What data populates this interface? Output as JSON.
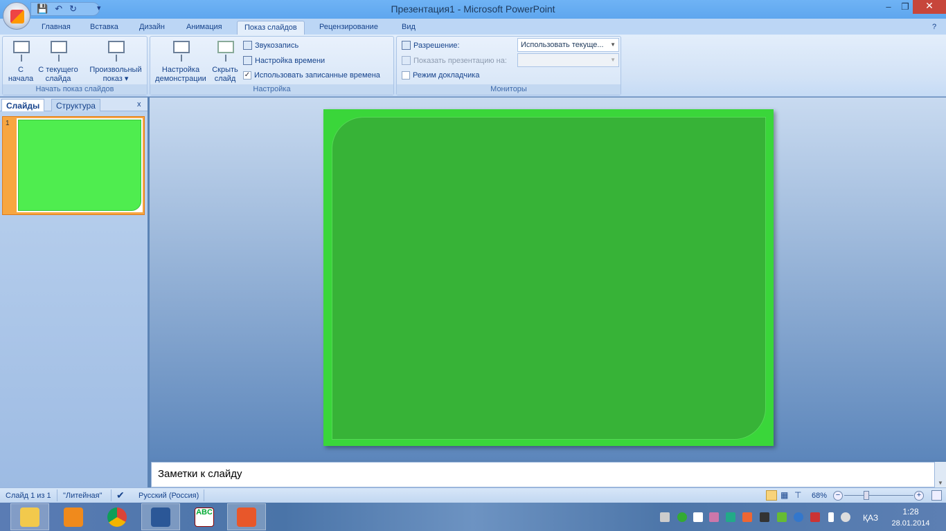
{
  "window": {
    "title": "Презентация1 - Microsoft PowerPoint"
  },
  "tabs": [
    "Главная",
    "Вставка",
    "Дизайн",
    "Анимация",
    "Показ слайдов",
    "Рецензирование",
    "Вид"
  ],
  "ribbon": {
    "start_group": {
      "label": "Начать показ слайдов",
      "from_start": "С\nначала",
      "from_start_l1": "С",
      "from_start_l2": "начала",
      "from_current_l1": "С текущего",
      "from_current_l2": "слайда",
      "custom_l1": "Произвольный",
      "custom_l2": "показ"
    },
    "setup_group": {
      "label": "Настройка",
      "setup_l1": "Настройка",
      "setup_l2": "демонстрации",
      "hide_l1": "Скрыть",
      "hide_l2": "слайд",
      "record": "Звукозапись",
      "rehearse": "Настройка времени",
      "use_timings": "Использовать записанные времена",
      "use_timings_checked": true
    },
    "monitors_group": {
      "label": "Мониторы",
      "resolution_label": "Разрешение:",
      "resolution_value": "Использовать текуще...",
      "show_on_label": "Показать презентацию на:",
      "show_on_value": "",
      "presenter_view": "Режим докладчика",
      "presenter_view_checked": false
    }
  },
  "left_pane": {
    "tab_slides": "Слайды",
    "tab_outline": "Структура",
    "close": "x",
    "slide_number": "1"
  },
  "notes": {
    "placeholder": "Заметки к слайду"
  },
  "status": {
    "slide": "Слайд 1 из 1",
    "theme": "\"Литейная\"",
    "language": "Русский (Россия)",
    "zoom": "68%",
    "zoom_percent": 68
  },
  "taskbar": {
    "apps": [
      "explorer",
      "media-player",
      "chrome",
      "word",
      "abc",
      "powerpoint"
    ],
    "lang": "ҚАЗ",
    "time": "1:28",
    "date": "28.01.2014"
  },
  "colors": {
    "slide_bg": "#3ad63a",
    "slide_inner": "#37b337",
    "accent": "#15428b"
  }
}
